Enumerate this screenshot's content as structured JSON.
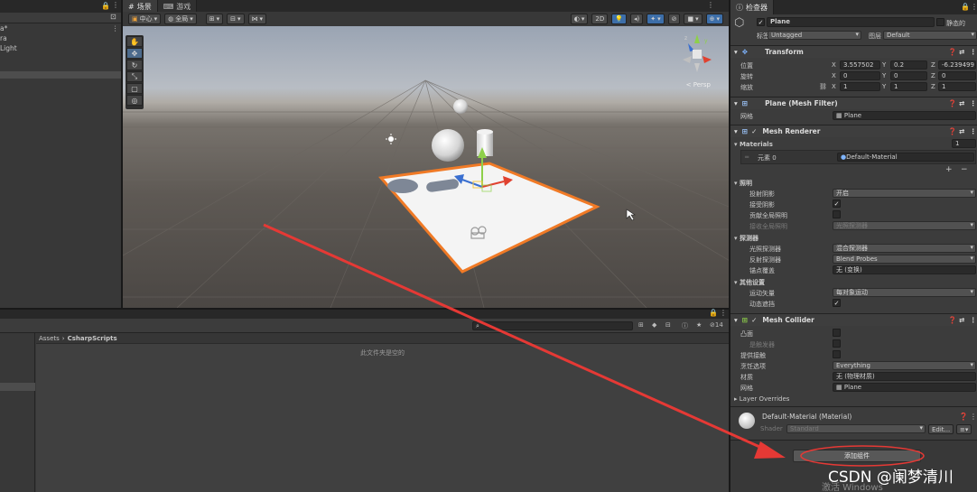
{
  "hierarchy": {
    "items": [
      "a*",
      "ra",
      "Light"
    ]
  },
  "scene": {
    "tabs": [
      {
        "label": "场景",
        "icon": "grid-icon"
      },
      {
        "label": "游戏",
        "icon": "gamepad-icon"
      }
    ],
    "toolbar": {
      "pivot": "中心",
      "space": "全局",
      "mode_2d": "2D"
    },
    "persp_label": "< Persp"
  },
  "inspector": {
    "tab": "检查器",
    "object_name": "Plane",
    "static_label": "静态的",
    "tag_label": "标签",
    "tag_value": "Untagged",
    "layer_label": "图层",
    "layer_value": "Default",
    "transform": {
      "title": "Transform",
      "position_label": "位置",
      "rotation_label": "旋转",
      "scale_label": "缩放",
      "position": {
        "x": "3.557502",
        "y": "0.2",
        "z": "-6.239499"
      },
      "rotation": {
        "x": "0",
        "y": "0",
        "z": "0"
      },
      "scale": {
        "x": "1",
        "y": "1",
        "z": "1"
      }
    },
    "mesh_filter": {
      "title": "Plane (Mesh Filter)",
      "mesh_label": "网格",
      "mesh_value": "Plane"
    },
    "mesh_renderer": {
      "title": "Mesh Renderer",
      "materials_label": "Materials",
      "materials_count": "1",
      "element_label": "元素 0",
      "element_value": "Default-Material",
      "lighting": {
        "title": "照明",
        "cast_shadows_label": "投射阴影",
        "cast_shadows_value": "开启",
        "receive_shadows_label": "接受阴影",
        "contribute_gi_label": "贡献全局照明",
        "receive_gi_label": "接收全局照明",
        "receive_gi_value": "光照探测器"
      },
      "probes": {
        "title": "探测器",
        "light_probes_label": "光照探测器",
        "light_probes_value": "混合探测器",
        "reflection_probes_label": "反射探测器",
        "reflection_probes_value": "Blend Probes",
        "anchor_label": "锚点覆盖",
        "anchor_value": "无 (变换)"
      },
      "additional": {
        "title": "其他设置",
        "motion_vectors_label": "运动矢量",
        "motion_vectors_value": "每对象运动",
        "dynamic_occlusion_label": "动态遮挡"
      }
    },
    "mesh_collider": {
      "title": "Mesh Collider",
      "convex_label": "凸面",
      "trigger_label": "是触发器",
      "contacts_label": "提供接触",
      "cooking_label": "烹饪选项",
      "cooking_value": "Everything",
      "material_label": "材质",
      "material_value": "无 (物理材质)",
      "mesh_label": "网格",
      "mesh_value": "Plane"
    },
    "layer_overrides_label": "Layer Overrides",
    "material_asset": {
      "title": "Default-Material (Material)",
      "shader_label": "Shader",
      "shader_value": "Standard",
      "edit_label": "Edit..."
    },
    "add_component_label": "添加组件"
  },
  "project": {
    "breadcrumb": [
      "Assets",
      "CsharpScripts"
    ],
    "empty_text": "此文件夹是空的",
    "hidden_count": "14"
  },
  "watermark": "CSDN @阑梦清川",
  "activate_text": "激活 Windows",
  "colors": {
    "selection_outline": "#f07a26",
    "arrow": "#e53935",
    "accent_blue": "#3d6ea8"
  }
}
